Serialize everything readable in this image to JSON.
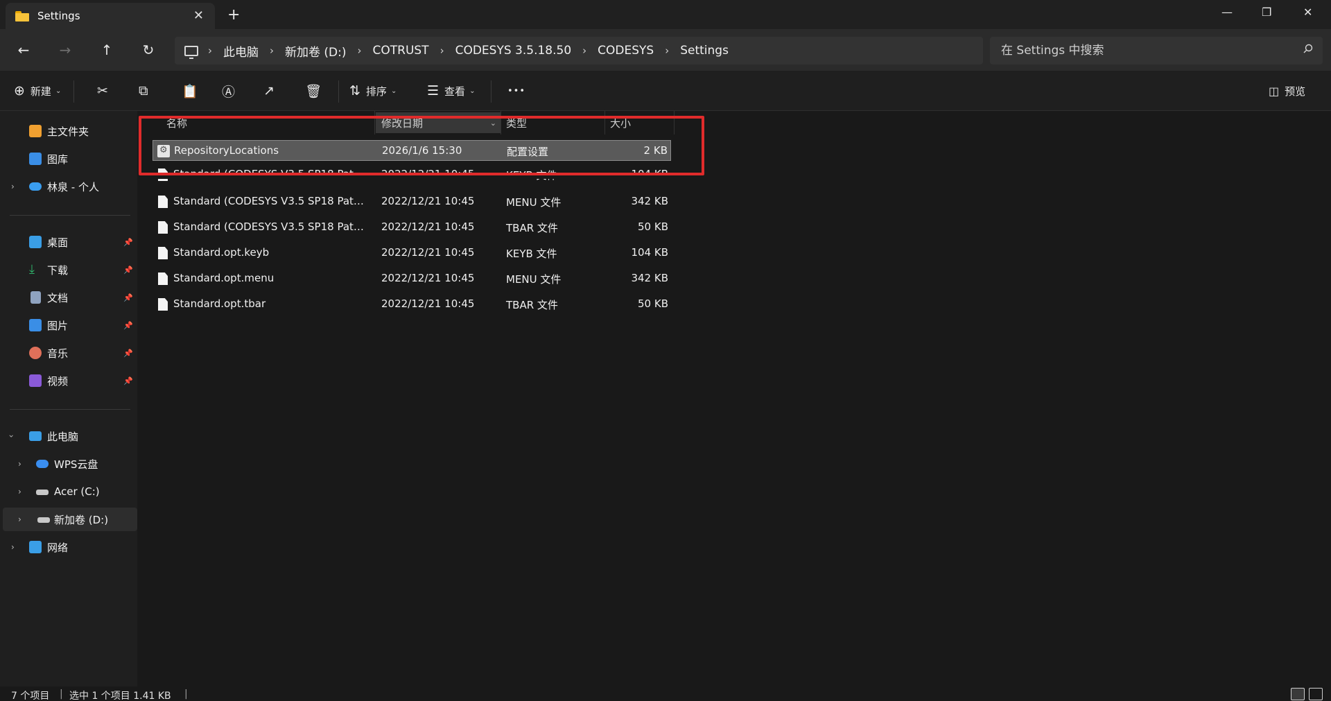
{
  "window": {
    "tab_title": "Settings",
    "tab_close_glyph": "✕",
    "new_tab_glyph": "+",
    "minimize_glyph": "—",
    "restore_glyph": "❐",
    "close_glyph": "✕"
  },
  "nav": {
    "back_glyph": "←",
    "forward_glyph": "→",
    "up_glyph": "↑",
    "refresh_glyph": "↻",
    "breadcrumb": [
      "此电脑",
      "新加卷 (D:)",
      "COTRUST",
      "CODESYS 3.5.18.50",
      "CODESYS",
      "Settings"
    ],
    "breadcrumb_sep": "›",
    "search_placeholder": "在 Settings 中搜索"
  },
  "toolbar": {
    "new_label": "新建",
    "sort_label": "排序",
    "view_label": "查看",
    "more_glyph": "•••",
    "preview_label": "预览",
    "icons": [
      "new-icon",
      "cut-icon",
      "copy-icon",
      "paste-icon",
      "rename-icon",
      "share-icon",
      "delete-icon",
      "sort-icon",
      "view-icon",
      "more-icon",
      "preview-pane-icon"
    ]
  },
  "sidebar": {
    "quick": [
      {
        "label": "主文件夹",
        "icon": "home-icon",
        "color": "#f0a030"
      },
      {
        "label": "图库",
        "icon": "gallery-icon",
        "color": "#3a8ee6"
      },
      {
        "label": "林泉 - 个人",
        "icon": "onedrive-icon",
        "color": "#3a9ef0"
      }
    ],
    "pinned": [
      {
        "label": "桌面",
        "icon": "desktop-icon",
        "color": "#3a9ee6"
      },
      {
        "label": "下载",
        "icon": "download-icon",
        "color": "#2fb36b"
      },
      {
        "label": "文档",
        "icon": "documents-icon",
        "color": "#8fa3c0"
      },
      {
        "label": "图片",
        "icon": "pictures-icon",
        "color": "#3a8ee6"
      },
      {
        "label": "音乐",
        "icon": "music-icon",
        "color": "#e0705a"
      },
      {
        "label": "视频",
        "icon": "videos-icon",
        "color": "#8a5ad8"
      }
    ],
    "pin_glyph": "📌",
    "tree": [
      {
        "label": "此电脑",
        "icon": "this-pc-icon",
        "color": "#3a9ee6"
      },
      {
        "label": "WPS云盘",
        "icon": "wps-cloud-icon",
        "color": "#3a8ef0"
      },
      {
        "label": "Acer (C:)",
        "icon": "drive-c-icon",
        "color": "#c8c8c8"
      },
      {
        "label": "新加卷 (D:)",
        "icon": "drive-d-icon",
        "color": "#c8c8c8"
      },
      {
        "label": "网络",
        "icon": "network-icon",
        "color": "#3a9ee6"
      }
    ]
  },
  "columns": {
    "name": "名称",
    "date": "修改日期",
    "type": "类型",
    "size": "大小"
  },
  "files": [
    {
      "name": "RepositoryLocations",
      "date": "2026/1/6 15:30",
      "type": "配置设置",
      "size": "2 KB"
    },
    {
      "name": "Standard (CODESYS V3.5 SP18 Patch ...",
      "date": "2022/12/21 10:45",
      "type": "KEYB 文件",
      "size": "104 KB"
    },
    {
      "name": "Standard (CODESYS V3.5 SP18 Patch ...",
      "date": "2022/12/21 10:45",
      "type": "MENU 文件",
      "size": "342 KB"
    },
    {
      "name": "Standard (CODESYS V3.5 SP18 Patch ...",
      "date": "2022/12/21 10:45",
      "type": "TBAR 文件",
      "size": "50 KB"
    },
    {
      "name": "Standard.opt.keyb",
      "date": "2022/12/21 10:45",
      "type": "KEYB 文件",
      "size": "104 KB"
    },
    {
      "name": "Standard.opt.menu",
      "date": "2022/12/21 10:45",
      "type": "MENU 文件",
      "size": "342 KB"
    },
    {
      "name": "Standard.opt.tbar",
      "date": "2022/12/21 10:45",
      "type": "TBAR 文件",
      "size": "50 KB"
    }
  ],
  "status": {
    "item_count": "7 个项目",
    "selection": "选中 1 个项目 1.41 KB"
  },
  "colors": {
    "highlight_box": "#e02b2b",
    "selected_row": "#5a5a5a"
  }
}
